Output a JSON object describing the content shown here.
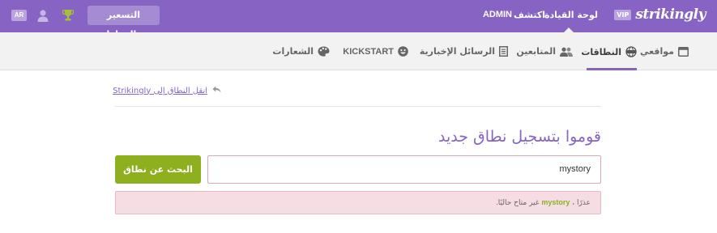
{
  "topbar": {
    "logo_badge": "VIP",
    "logo_text": "strikingly",
    "nav": {
      "dashboard": "لوحة القيادة",
      "explore": "اكتشف",
      "admin": "ADMIN"
    },
    "pricing_button": "التسعير والخطط",
    "language": "AR",
    "icons": [
      "trophy-icon",
      "user-icon"
    ],
    "accent_color": "#8764c4"
  },
  "subnav": {
    "tabs": [
      {
        "id": "sites",
        "label": "مواقعي",
        "icon": "window-icon"
      },
      {
        "id": "domains",
        "label": "النطاقات",
        "icon": "www-globe-icon",
        "active": true
      },
      {
        "id": "followers",
        "label": "المتابعين",
        "icon": "users-icon"
      },
      {
        "id": "newsletters",
        "label": "الرسائل الإخبارية",
        "icon": "newsletter-icon"
      },
      {
        "id": "kickstart",
        "label": "KICKSTART",
        "icon": "smiley-icon"
      },
      {
        "id": "logos",
        "label": "الشعارات",
        "icon": "palette-icon"
      }
    ]
  },
  "main": {
    "back_link": "Strikingly انقل النطاق إلى",
    "title": "قوموا بتسجيل نطاق جديد",
    "input_value": "mystory",
    "search_button": "البحث عن نطاق",
    "error": {
      "prefix": "عذرًا ،",
      "domain": "mystory",
      "suffix": "غير متاح حاليًا."
    },
    "button_color": "#8eb01f",
    "error_bg_color": "#f6dde3"
  }
}
